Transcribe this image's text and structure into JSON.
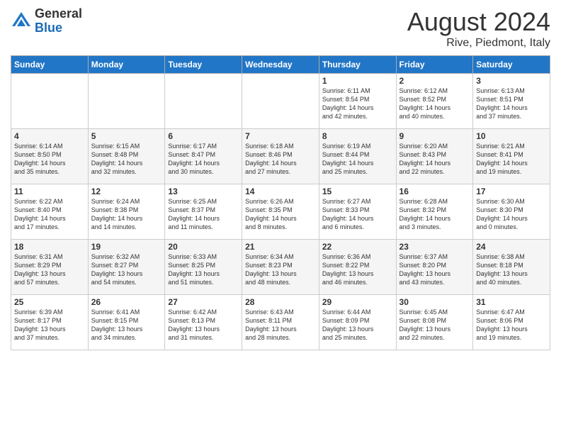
{
  "logo": {
    "general": "General",
    "blue": "Blue"
  },
  "header": {
    "month_year": "August 2024",
    "location": "Rive, Piedmont, Italy"
  },
  "days_of_week": [
    "Sunday",
    "Monday",
    "Tuesday",
    "Wednesday",
    "Thursday",
    "Friday",
    "Saturday"
  ],
  "weeks": [
    [
      {
        "day": "",
        "info": ""
      },
      {
        "day": "",
        "info": ""
      },
      {
        "day": "",
        "info": ""
      },
      {
        "day": "",
        "info": ""
      },
      {
        "day": "1",
        "info": "Sunrise: 6:11 AM\nSunset: 8:54 PM\nDaylight: 14 hours\nand 42 minutes."
      },
      {
        "day": "2",
        "info": "Sunrise: 6:12 AM\nSunset: 8:52 PM\nDaylight: 14 hours\nand 40 minutes."
      },
      {
        "day": "3",
        "info": "Sunrise: 6:13 AM\nSunset: 8:51 PM\nDaylight: 14 hours\nand 37 minutes."
      }
    ],
    [
      {
        "day": "4",
        "info": "Sunrise: 6:14 AM\nSunset: 8:50 PM\nDaylight: 14 hours\nand 35 minutes."
      },
      {
        "day": "5",
        "info": "Sunrise: 6:15 AM\nSunset: 8:48 PM\nDaylight: 14 hours\nand 32 minutes."
      },
      {
        "day": "6",
        "info": "Sunrise: 6:17 AM\nSunset: 8:47 PM\nDaylight: 14 hours\nand 30 minutes."
      },
      {
        "day": "7",
        "info": "Sunrise: 6:18 AM\nSunset: 8:46 PM\nDaylight: 14 hours\nand 27 minutes."
      },
      {
        "day": "8",
        "info": "Sunrise: 6:19 AM\nSunset: 8:44 PM\nDaylight: 14 hours\nand 25 minutes."
      },
      {
        "day": "9",
        "info": "Sunrise: 6:20 AM\nSunset: 8:43 PM\nDaylight: 14 hours\nand 22 minutes."
      },
      {
        "day": "10",
        "info": "Sunrise: 6:21 AM\nSunset: 8:41 PM\nDaylight: 14 hours\nand 19 minutes."
      }
    ],
    [
      {
        "day": "11",
        "info": "Sunrise: 6:22 AM\nSunset: 8:40 PM\nDaylight: 14 hours\nand 17 minutes."
      },
      {
        "day": "12",
        "info": "Sunrise: 6:24 AM\nSunset: 8:38 PM\nDaylight: 14 hours\nand 14 minutes."
      },
      {
        "day": "13",
        "info": "Sunrise: 6:25 AM\nSunset: 8:37 PM\nDaylight: 14 hours\nand 11 minutes."
      },
      {
        "day": "14",
        "info": "Sunrise: 6:26 AM\nSunset: 8:35 PM\nDaylight: 14 hours\nand 8 minutes."
      },
      {
        "day": "15",
        "info": "Sunrise: 6:27 AM\nSunset: 8:33 PM\nDaylight: 14 hours\nand 6 minutes."
      },
      {
        "day": "16",
        "info": "Sunrise: 6:28 AM\nSunset: 8:32 PM\nDaylight: 14 hours\nand 3 minutes."
      },
      {
        "day": "17",
        "info": "Sunrise: 6:30 AM\nSunset: 8:30 PM\nDaylight: 14 hours\nand 0 minutes."
      }
    ],
    [
      {
        "day": "18",
        "info": "Sunrise: 6:31 AM\nSunset: 8:29 PM\nDaylight: 13 hours\nand 57 minutes."
      },
      {
        "day": "19",
        "info": "Sunrise: 6:32 AM\nSunset: 8:27 PM\nDaylight: 13 hours\nand 54 minutes."
      },
      {
        "day": "20",
        "info": "Sunrise: 6:33 AM\nSunset: 8:25 PM\nDaylight: 13 hours\nand 51 minutes."
      },
      {
        "day": "21",
        "info": "Sunrise: 6:34 AM\nSunset: 8:23 PM\nDaylight: 13 hours\nand 48 minutes."
      },
      {
        "day": "22",
        "info": "Sunrise: 6:36 AM\nSunset: 8:22 PM\nDaylight: 13 hours\nand 46 minutes."
      },
      {
        "day": "23",
        "info": "Sunrise: 6:37 AM\nSunset: 8:20 PM\nDaylight: 13 hours\nand 43 minutes."
      },
      {
        "day": "24",
        "info": "Sunrise: 6:38 AM\nSunset: 8:18 PM\nDaylight: 13 hours\nand 40 minutes."
      }
    ],
    [
      {
        "day": "25",
        "info": "Sunrise: 6:39 AM\nSunset: 8:17 PM\nDaylight: 13 hours\nand 37 minutes."
      },
      {
        "day": "26",
        "info": "Sunrise: 6:41 AM\nSunset: 8:15 PM\nDaylight: 13 hours\nand 34 minutes."
      },
      {
        "day": "27",
        "info": "Sunrise: 6:42 AM\nSunset: 8:13 PM\nDaylight: 13 hours\nand 31 minutes."
      },
      {
        "day": "28",
        "info": "Sunrise: 6:43 AM\nSunset: 8:11 PM\nDaylight: 13 hours\nand 28 minutes."
      },
      {
        "day": "29",
        "info": "Sunrise: 6:44 AM\nSunset: 8:09 PM\nDaylight: 13 hours\nand 25 minutes."
      },
      {
        "day": "30",
        "info": "Sunrise: 6:45 AM\nSunset: 8:08 PM\nDaylight: 13 hours\nand 22 minutes."
      },
      {
        "day": "31",
        "info": "Sunrise: 6:47 AM\nSunset: 8:06 PM\nDaylight: 13 hours\nand 19 minutes."
      }
    ]
  ]
}
